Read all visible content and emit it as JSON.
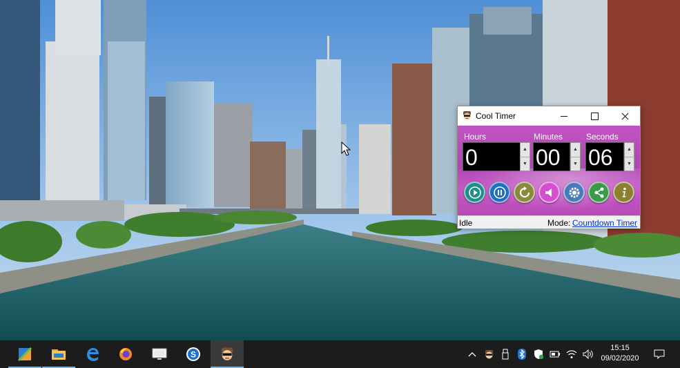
{
  "window": {
    "title": "Cool Timer",
    "labels": {
      "hours": "Hours",
      "minutes": "Minutes",
      "seconds": "Seconds"
    },
    "values": {
      "hours": "0",
      "minutes": "00",
      "seconds": "06"
    },
    "status": "Idle",
    "mode_label": "Mode:",
    "mode_value": "Countdown Timer",
    "controls": [
      {
        "name": "play",
        "icon": "play-icon"
      },
      {
        "name": "pause",
        "icon": "pause-icon"
      },
      {
        "name": "reset",
        "icon": "reset-icon"
      },
      {
        "name": "sound",
        "icon": "speaker-icon"
      },
      {
        "name": "settings",
        "icon": "gear-icon"
      },
      {
        "name": "share",
        "icon": "share-icon"
      },
      {
        "name": "info",
        "icon": "info-icon"
      }
    ],
    "colors": {
      "body": "#b84bb8",
      "display": "#000000",
      "link": "#0033cc"
    }
  },
  "taskbar": {
    "apps": [
      {
        "name": "start",
        "icon": "windows-icon",
        "active": false
      },
      {
        "name": "file-explorer",
        "icon": "folder-icon",
        "active": false
      },
      {
        "name": "edge",
        "icon": "edge-icon",
        "active": false
      },
      {
        "name": "firefox",
        "icon": "firefox-icon",
        "active": false
      },
      {
        "name": "remote-desktop",
        "icon": "monitor-icon",
        "active": false
      },
      {
        "name": "app-s",
        "icon": "s-logo-icon",
        "active": false
      },
      {
        "name": "cool-timer",
        "icon": "cool-timer-icon",
        "active": true
      }
    ],
    "tray_icons": [
      "chevron-up-icon",
      "cool-timer-tray-icon",
      "usb-icon",
      "bluetooth-icon",
      "shield-icon",
      "battery-icon",
      "wifi-icon",
      "volume-icon"
    ],
    "clock": {
      "time": "15:15",
      "date": "09/02/2020"
    },
    "notification_icon": "notification-icon"
  }
}
